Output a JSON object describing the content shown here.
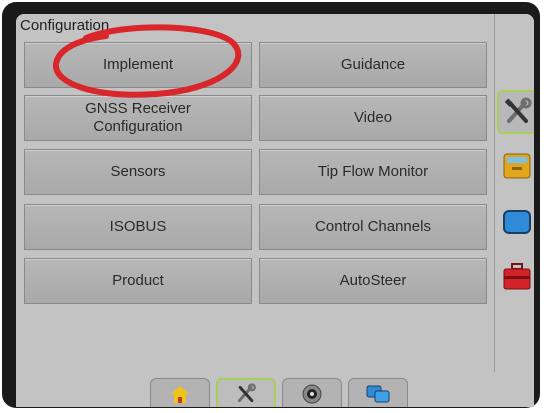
{
  "panel": {
    "title": "Configuration"
  },
  "menu": {
    "implement": "Implement",
    "guidance": "Guidance",
    "gnss": "GNSS Receiver\nConfiguration",
    "video": "Video",
    "sensors": "Sensors",
    "tip_flow": "Tip Flow Monitor",
    "isobus": "ISOBUS",
    "control_channels": "Control Channels",
    "product": "Product",
    "autosteer": "AutoSteer"
  },
  "side_tabs": [
    {
      "icon": "tools-icon",
      "active": true
    },
    {
      "icon": "console-icon",
      "active": false
    },
    {
      "icon": "display-icon",
      "active": false
    },
    {
      "icon": "toolbox-icon",
      "active": false
    }
  ],
  "bottom_tabs": [
    {
      "icon": "home-icon",
      "active": false
    },
    {
      "icon": "tools-icon",
      "active": true
    },
    {
      "icon": "camera-icon",
      "active": false
    },
    {
      "icon": "screens-icon",
      "active": false
    }
  ],
  "colors": {
    "active_outline": "#a7cf55",
    "highlight_ellipse": "#d9262b"
  }
}
